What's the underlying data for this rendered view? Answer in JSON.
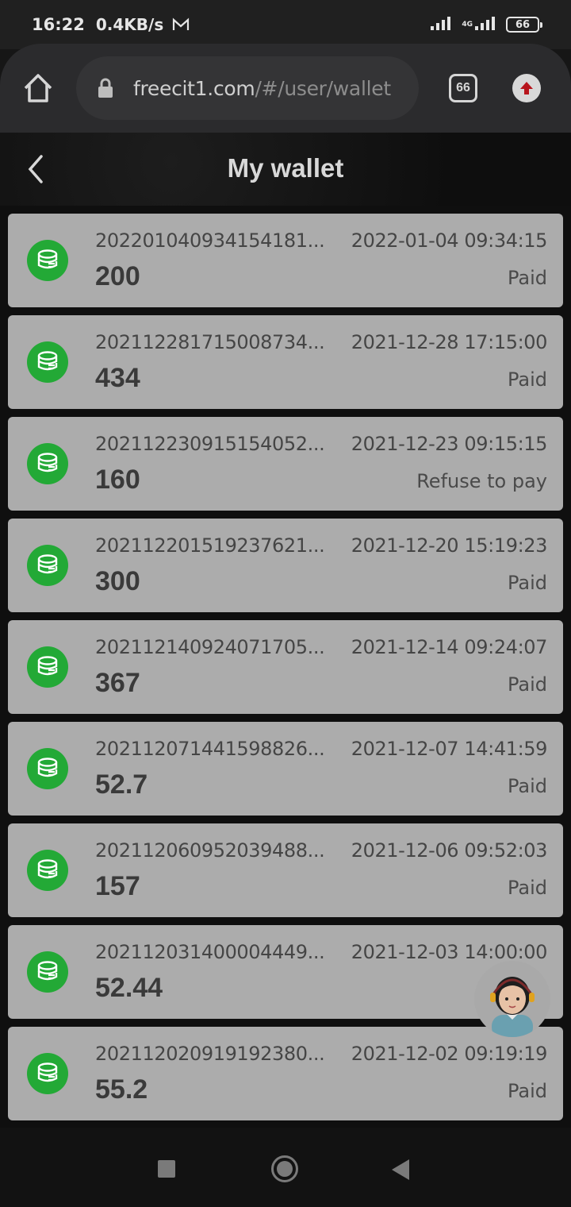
{
  "status_bar": {
    "time": "16:22",
    "speed": "0.4KB/s",
    "network": "4G",
    "battery": "66"
  },
  "browser": {
    "url_host": "freecit1.com",
    "url_path": "/#/user/wallet",
    "tab_count": "66"
  },
  "header": {
    "title": "My wallet"
  },
  "transactions": [
    {
      "id": "202201040934154181...",
      "date": "2022-01-04 09:34:15",
      "amount": "200",
      "status": "Paid"
    },
    {
      "id": "202112281715008734...",
      "date": "2021-12-28 17:15:00",
      "amount": "434",
      "status": "Paid"
    },
    {
      "id": "202112230915154052...",
      "date": "2021-12-23 09:15:15",
      "amount": "160",
      "status": "Refuse to pay"
    },
    {
      "id": "202112201519237621...",
      "date": "2021-12-20 15:19:23",
      "amount": "300",
      "status": "Paid"
    },
    {
      "id": "202112140924071705...",
      "date": "2021-12-14 09:24:07",
      "amount": "367",
      "status": "Paid"
    },
    {
      "id": "202112071441598826...",
      "date": "2021-12-07 14:41:59",
      "amount": "52.7",
      "status": "Paid"
    },
    {
      "id": "202112060952039488...",
      "date": "2021-12-06 09:52:03",
      "amount": "157",
      "status": "Paid"
    },
    {
      "id": "202112031400004449...",
      "date": "2021-12-03 14:00:00",
      "amount": "52.44",
      "status": ""
    },
    {
      "id": "202112020919192380...",
      "date": "2021-12-02 09:19:19",
      "amount": "55.2",
      "status": "Paid"
    }
  ],
  "colors": {
    "coin_green": "#23a936",
    "card_bg": "#acacac",
    "page_bg": "#0f0f0f"
  },
  "icons": {
    "home": "home-icon",
    "lock": "lock-icon",
    "upload": "upload-icon",
    "back": "chevron-left-icon",
    "coin": "coin-stack-icon",
    "support": "customer-support-avatar"
  }
}
